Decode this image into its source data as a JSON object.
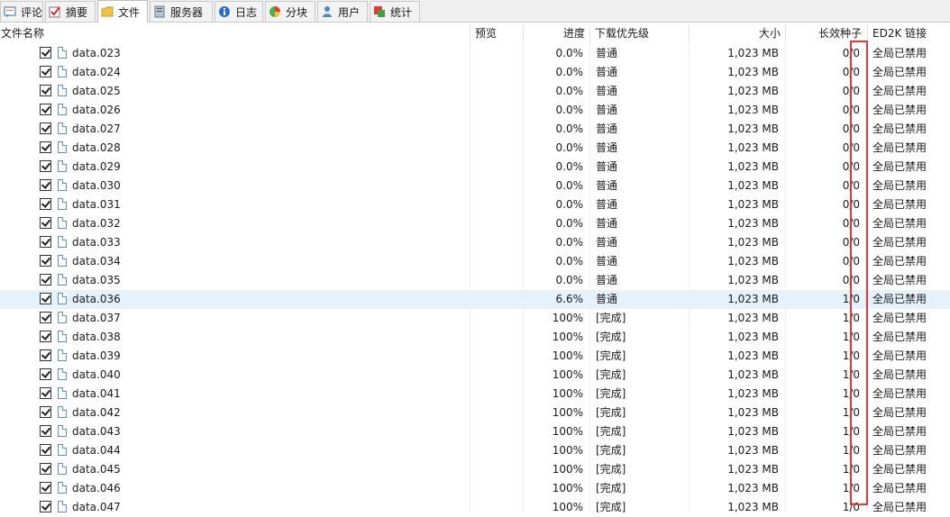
{
  "tabs": [
    {
      "label": "评论",
      "icon": "comment-icon",
      "active": false
    },
    {
      "label": "摘要",
      "icon": "summary-icon",
      "active": false
    },
    {
      "label": "文件",
      "icon": "folder-icon",
      "active": true
    },
    {
      "label": "服务器",
      "icon": "server-icon",
      "active": false
    },
    {
      "label": "日志",
      "icon": "info-icon",
      "active": false
    },
    {
      "label": "分块",
      "icon": "pie-icon",
      "active": false
    },
    {
      "label": "用户",
      "icon": "user-icon",
      "active": false
    },
    {
      "label": "统计",
      "icon": "stats-icon",
      "active": false
    }
  ],
  "columns": {
    "name": "文件名称",
    "preview": "预览",
    "progress": "进度",
    "priority": "下载优先级",
    "size": "大小",
    "seeds": "长效种子",
    "ed2k": "ED2K 链接"
  },
  "rows": [
    {
      "name": "data.023",
      "progress": "0.0%",
      "priority": "普通",
      "size": "1,023 MB",
      "seeds": "0/0",
      "ed2k": "全局已禁用"
    },
    {
      "name": "data.024",
      "progress": "0.0%",
      "priority": "普通",
      "size": "1,023 MB",
      "seeds": "0/0",
      "ed2k": "全局已禁用"
    },
    {
      "name": "data.025",
      "progress": "0.0%",
      "priority": "普通",
      "size": "1,023 MB",
      "seeds": "0/0",
      "ed2k": "全局已禁用"
    },
    {
      "name": "data.026",
      "progress": "0.0%",
      "priority": "普通",
      "size": "1,023 MB",
      "seeds": "0/0",
      "ed2k": "全局已禁用"
    },
    {
      "name": "data.027",
      "progress": "0.0%",
      "priority": "普通",
      "size": "1,023 MB",
      "seeds": "0/0",
      "ed2k": "全局已禁用"
    },
    {
      "name": "data.028",
      "progress": "0.0%",
      "priority": "普通",
      "size": "1,023 MB",
      "seeds": "0/0",
      "ed2k": "全局已禁用"
    },
    {
      "name": "data.029",
      "progress": "0.0%",
      "priority": "普通",
      "size": "1,023 MB",
      "seeds": "0/0",
      "ed2k": "全局已禁用"
    },
    {
      "name": "data.030",
      "progress": "0.0%",
      "priority": "普通",
      "size": "1,023 MB",
      "seeds": "0/0",
      "ed2k": "全局已禁用"
    },
    {
      "name": "data.031",
      "progress": "0.0%",
      "priority": "普通",
      "size": "1,023 MB",
      "seeds": "0/0",
      "ed2k": "全局已禁用"
    },
    {
      "name": "data.032",
      "progress": "0.0%",
      "priority": "普通",
      "size": "1,023 MB",
      "seeds": "0/0",
      "ed2k": "全局已禁用"
    },
    {
      "name": "data.033",
      "progress": "0.0%",
      "priority": "普通",
      "size": "1,023 MB",
      "seeds": "0/0",
      "ed2k": "全局已禁用"
    },
    {
      "name": "data.034",
      "progress": "0.0%",
      "priority": "普通",
      "size": "1,023 MB",
      "seeds": "0/0",
      "ed2k": "全局已禁用"
    },
    {
      "name": "data.035",
      "progress": "0.0%",
      "priority": "普通",
      "size": "1,023 MB",
      "seeds": "0/0",
      "ed2k": "全局已禁用"
    },
    {
      "name": "data.036",
      "progress": "6.6%",
      "priority": "普通",
      "size": "1,023 MB",
      "seeds": "1/0",
      "ed2k": "全局已禁用",
      "selected": true
    },
    {
      "name": "data.037",
      "progress": "100%",
      "priority": "[完成]",
      "size": "1,023 MB",
      "seeds": "1/0",
      "ed2k": "全局已禁用"
    },
    {
      "name": "data.038",
      "progress": "100%",
      "priority": "[完成]",
      "size": "1,023 MB",
      "seeds": "1/0",
      "ed2k": "全局已禁用"
    },
    {
      "name": "data.039",
      "progress": "100%",
      "priority": "[完成]",
      "size": "1,023 MB",
      "seeds": "1/0",
      "ed2k": "全局已禁用"
    },
    {
      "name": "data.040",
      "progress": "100%",
      "priority": "[完成]",
      "size": "1,023 MB",
      "seeds": "1/0",
      "ed2k": "全局已禁用"
    },
    {
      "name": "data.041",
      "progress": "100%",
      "priority": "[完成]",
      "size": "1,023 MB",
      "seeds": "1/0",
      "ed2k": "全局已禁用"
    },
    {
      "name": "data.042",
      "progress": "100%",
      "priority": "[完成]",
      "size": "1,023 MB",
      "seeds": "1/0",
      "ed2k": "全局已禁用"
    },
    {
      "name": "data.043",
      "progress": "100%",
      "priority": "[完成]",
      "size": "1,023 MB",
      "seeds": "1/0",
      "ed2k": "全局已禁用"
    },
    {
      "name": "data.044",
      "progress": "100%",
      "priority": "[完成]",
      "size": "1,023 MB",
      "seeds": "1/0",
      "ed2k": "全局已禁用"
    },
    {
      "name": "data.045",
      "progress": "100%",
      "priority": "[完成]",
      "size": "1,023 MB",
      "seeds": "1/0",
      "ed2k": "全局已禁用"
    },
    {
      "name": "data.046",
      "progress": "100%",
      "priority": "[完成]",
      "size": "1,023 MB",
      "seeds": "1/0",
      "ed2k": "全局已禁用"
    },
    {
      "name": "data.047",
      "progress": "100%",
      "priority": "[完成]",
      "size": "1,023 MB",
      "seeds": "1/0",
      "ed2k": "全局已禁用"
    }
  ],
  "highlight_color": "#e53935",
  "selected_row_color": "#e5f1fb"
}
